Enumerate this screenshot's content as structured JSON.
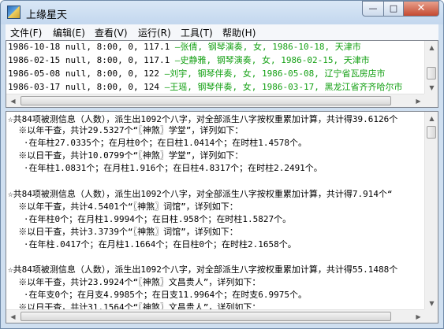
{
  "window": {
    "title": "上缘星天"
  },
  "window_controls": {
    "minimize": "—",
    "maximize": "□",
    "close": "✕"
  },
  "menu": [
    {
      "label": "文件(F)"
    },
    {
      "label": "编辑(E)"
    },
    {
      "label": "查看(V)"
    },
    {
      "label": "运行(R)"
    },
    {
      "label": "工具(T)"
    },
    {
      "label": "帮助(H)"
    }
  ],
  "records": [
    {
      "data": "1986-10-18 null, 8:00, 0, 117.1 ",
      "person": "—张倩, 钢琴演奏, 女, 1986-10-18, 天津市"
    },
    {
      "data": "1986-02-15 null, 8:00, 0, 117.1 ",
      "person": "—史静雅, 钢琴演奏, 女, 1986-02-15, 天津市"
    },
    {
      "data": "1986-05-08 null, 8:00, 0, 122 ",
      "person": "—刘宇, 钢琴伴奏, 女, 1986-05-08, 辽宁省瓦房店市"
    },
    {
      "data": "1986-03-17 null, 8:00, 0, 124 ",
      "person": "—王瑶, 钢琴伴奏, 女, 1986-03-17, 黑龙江省齐齐哈尔市"
    }
  ],
  "results": [
    "☆共84项被测信息（人数），派生出1092个八字，对全部派生八字按权重累加计算，共计得39.6126个",
    "  ※以年干查，共计29.5327个“〖神煞〗学堂”，详列如下：",
    "   ·在年柱27.0335个；在月柱0个；在日柱1.0414个；在时柱1.4578个。",
    "  ※以日干查，共计10.0799个“〖神煞〗学堂”，详列如下：",
    "   ·在年柱1.0831个；在月柱1.916个；在日柱4.8317个；在时柱2.2491个。",
    "",
    "☆共84项被测信息（人数），派生出1092个八字，对全部派生八字按权重累加计算，共计得7.914个“",
    "  ※以年干查，共计4.5401个“〖神煞〗词馆”，详列如下：",
    "   ·在年柱0个；在月柱1.9994个；在日柱.958个；在时柱1.5827个。",
    "  ※以日干查，共计3.3739个“〖神煞〗词馆”，详列如下：",
    "   ·在年柱.0417个；在月柱1.1664个；在日柱0个；在时柱2.1658个。",
    "",
    "☆共84项被测信息（人数），派生出1092个八字，对全部派生八字按权重累加计算，共计得55.1488个",
    "  ※以年干查，共计23.9924个“〖神煞〗文昌贵人”，详列如下：",
    "   ·在年支0个；在月支4.9985个；在日支11.9964个；在时支6.9975个。",
    "  ※以日干查，共计31.1564个“〖神煞〗文昌贵人”，详列如下："
  ]
}
